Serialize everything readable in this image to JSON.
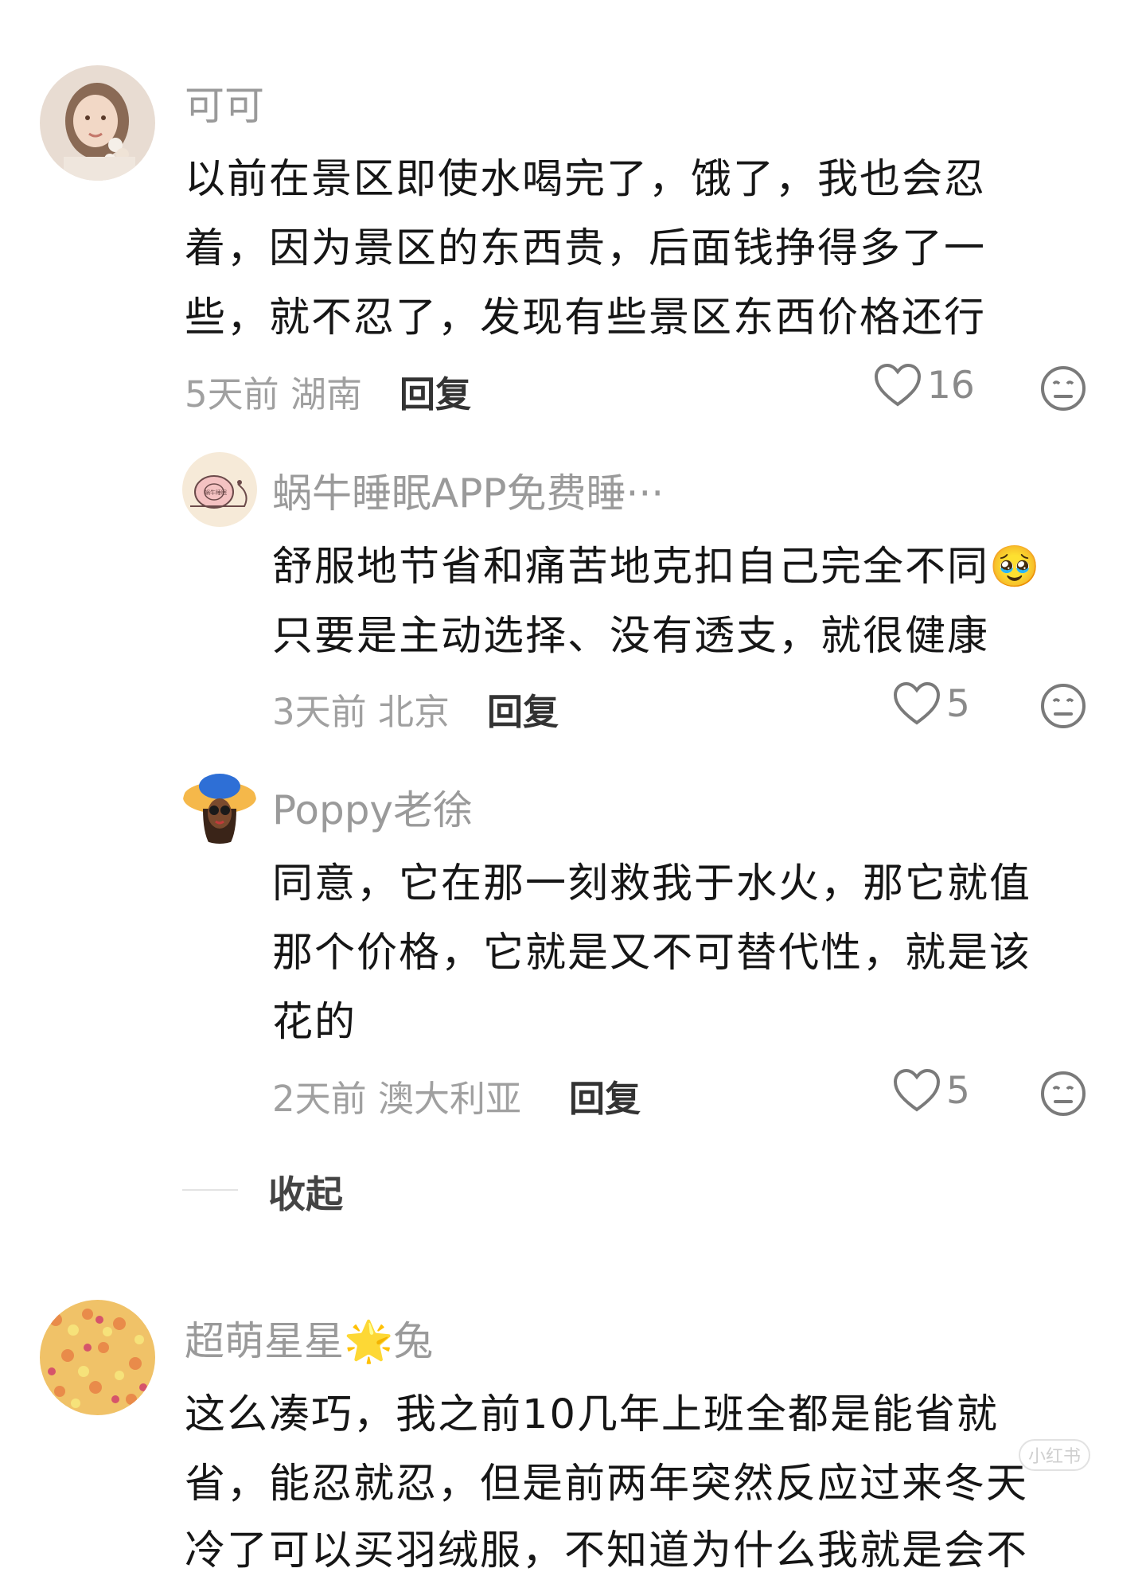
{
  "comments": [
    {
      "name": "可可",
      "lines": [
        "以前在景区即使水喝完了，饿了，我也会忍",
        "着，因为景区的东西贵，后面钱挣得多了一",
        "些，就不忍了，发现有些景区东西价格还行"
      ],
      "time": "5天前",
      "location": "湖南",
      "reply_label": "回复",
      "likes": "16",
      "avatar_icon": "woman-with-flowers-avatar",
      "replies": [
        {
          "name": "蜗牛睡眠APP免费睡···",
          "lines": [
            "舒服地节省和痛苦地克扣自己完全不同🥹",
            "只要是主动选择、没有透支，就很健康"
          ],
          "time": "3天前",
          "location": "北京",
          "reply_label": "回复",
          "likes": "5",
          "avatar_icon": "snail-avatar",
          "avatar_text": "蜗牛睡眠"
        },
        {
          "name": "Poppy老徐",
          "lines": [
            "同意，它在那一刻救我于水火，那它就值",
            "那个价格，它就是又不可替代性，就是该",
            "花的"
          ],
          "time": "2天前",
          "location": "澳大利亚",
          "reply_label": "回复",
          "likes": "5",
          "avatar_icon": "cartoon-girl-sunhat-avatar"
        }
      ],
      "collapse_label": "收起"
    },
    {
      "name": "超萌星星🌟兔",
      "lines": [
        "这么凑巧，我之前10几年上班全都是能省就",
        "省，能忍就忍，但是前两年突然反应过来冬天",
        "冷了可以买羽绒服，不知道为什么我就是会不"
      ],
      "avatar_icon": "colorful-cereal-avatar"
    }
  ],
  "watermark": "小红书"
}
